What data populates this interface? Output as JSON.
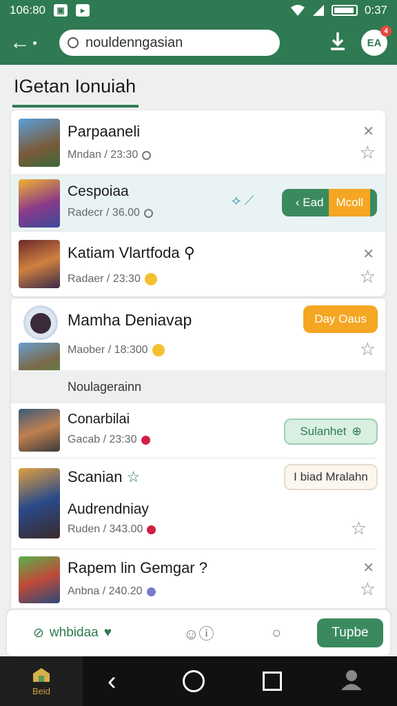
{
  "status": {
    "time_left": "106:80",
    "time_right": "0:37"
  },
  "appbar": {
    "search_value": "nouldenngasian",
    "notification_count": "4"
  },
  "page": {
    "title": "IGetan Ionuiah"
  },
  "items": [
    {
      "title": "Parpaaneli",
      "meta": "Mndan / 23:30"
    },
    {
      "title": "Cespoiaa",
      "meta": "Radecr / 36.00",
      "action": "Ead",
      "action_tag": "Mcoll"
    },
    {
      "title": "Katiam Vlartfoda",
      "meta": "Radaer / 23:30"
    },
    {
      "title": "Mamha Deniavap",
      "meta": "Maober / 18:300",
      "action": "Day Oaus"
    },
    {
      "title": "Conarbilai",
      "meta": "Gacab / 23:30",
      "action": "Sulanhet"
    },
    {
      "title": "Scanian",
      "subtitle": "Audrendniay",
      "meta": "Ruden / 343.00",
      "action": "I biad Mralahn"
    },
    {
      "title": "Rapem lin Gemgar ?",
      "meta": "Anbna / 240.20"
    }
  ],
  "section_header": "Noulagerainn",
  "bottom_bar": {
    "app_label": "whbidaa",
    "primary_button": "Tupbe"
  },
  "navbar": {
    "home_label": "Beid"
  },
  "colors": {
    "primary": "#2f7a52",
    "accent_orange": "#f5a623",
    "highlight_row": "#e9f3f4"
  }
}
